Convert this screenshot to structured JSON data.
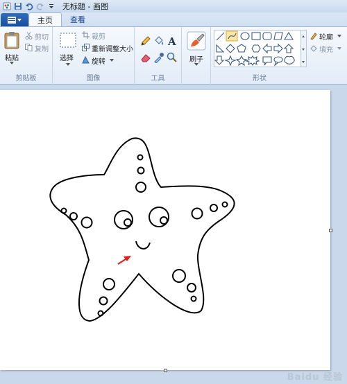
{
  "title_bar": {
    "title": "无标题 - 画图",
    "icons": [
      "paint-app-icon",
      "save-icon",
      "undo-icon",
      "redo-icon",
      "customize-qat-icon"
    ]
  },
  "tabs": {
    "file_menu_icon": "file-menu-icon",
    "items": [
      {
        "label": "主页",
        "active": true
      },
      {
        "label": "查看",
        "active": false
      }
    ]
  },
  "ribbon": {
    "clipboard": {
      "paste": "粘贴",
      "cut": "剪切",
      "copy": "复制",
      "group_label": "剪贴板"
    },
    "image": {
      "select": "选择",
      "crop": "裁剪",
      "resize": "重新调整大小",
      "rotate": "旋转",
      "group_label": "图像"
    },
    "tools": {
      "group_label": "工具",
      "items": [
        "pencil-icon",
        "fill-icon",
        "text-icon",
        "eraser-icon",
        "color-picker-icon",
        "magnifier-icon"
      ]
    },
    "brushes": {
      "label": "刷子"
    },
    "shapes": {
      "group_label": "形状",
      "outline": "轮廓",
      "fill": "填充"
    }
  },
  "canvas": {
    "drawing": "starfish-drawing",
    "pointer_color": "#e02020"
  },
  "watermark": {
    "text": "Baidu 经验"
  },
  "colors": {
    "accent": "#1a4f9d",
    "ribbon_bg": "#e2ecf8",
    "workspace_bg": "#c9d8ea"
  }
}
